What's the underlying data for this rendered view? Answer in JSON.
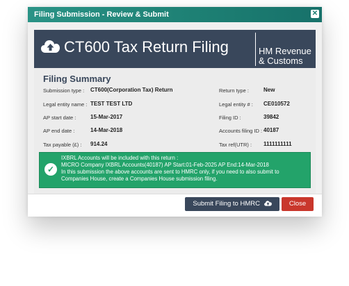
{
  "dialog": {
    "title": "Filing Submission - Review & Submit",
    "close_glyph": "✕"
  },
  "banner": {
    "heading": "CT600 Tax Return Filing",
    "org_line1": "HM Revenue",
    "org_line2": "& Customs",
    "icon": "cloud-upload-icon"
  },
  "summary": {
    "title": "Filing Summary",
    "left": [
      {
        "label": "Submission type :",
        "value": "CT600(Corporation Tax) Return"
      },
      {
        "label": "Legal entity name :",
        "value": "TEST TEST LTD"
      },
      {
        "label": "AP start date :",
        "value": "15-Mar-2017"
      },
      {
        "label": "AP end date :",
        "value": "14-Mar-2018"
      },
      {
        "label": "Tax payable (£) :",
        "value": "914.24"
      }
    ],
    "right": [
      {
        "label": "Return type :",
        "value": "New"
      },
      {
        "label": "Legal entity # :",
        "value": "CE010572"
      },
      {
        "label": "Filing ID :",
        "value": "39842"
      },
      {
        "label": "Accounts filing ID :",
        "value": "40187"
      },
      {
        "label": "Tax ref(UTR) :",
        "value": "1111111111"
      }
    ]
  },
  "notice": {
    "line1": "IXBRL Accounts will be included with this return :",
    "line2": "MICRO Company IXBRL Accounts(40187) AP Start:01-Feb-2025 AP End:14-Mar-2018",
    "line3": "In this submission the above accounts are sent to HMRC only, if you need to also submit to Companies House, create a Companies House submission filing.",
    "check_glyph": "✓"
  },
  "footer": {
    "submit_label": "Submit Filing to HMRC",
    "close_label": "Close"
  },
  "colors": {
    "titlebar": "#1d7f73",
    "banner": "#39475b",
    "notice": "#23a36a",
    "close_button": "#c9372c"
  }
}
